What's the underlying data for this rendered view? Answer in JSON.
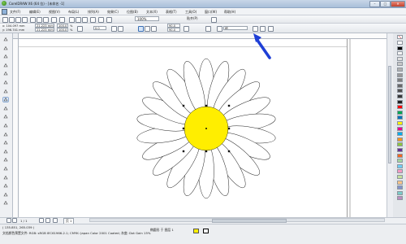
{
  "window": {
    "title": "CorelDRAW X6 (64 位) - [未命名 -1]",
    "minimize": "–",
    "maximize": "□",
    "close": "✕"
  },
  "menu": [
    "文件(F)",
    "编辑(E)",
    "视图(V)",
    "布局(L)",
    "排列(A)",
    "效果(C)",
    "位图(B)",
    "文本(X)",
    "表格(T)",
    "工具(O)",
    "窗口(W)",
    "帮助(H)"
  ],
  "toolbar": {
    "zoom": "100%",
    "snap": "贴齐(P)"
  },
  "property_bar": {
    "x": "x: 104.097 mm",
    "y": "y: 196.741 mm",
    "w": "21.223 mm",
    "h": "21.223 mm",
    "scale_w": "100.0",
    "scale_h": "100.0",
    "percent": "%",
    "angle": "0.0",
    "start_angle": "90.0",
    "end_angle": "90.0",
    "outline": "细"
  },
  "page_nav": {
    "counter": "1 / 1",
    "page_tab": "页 1"
  },
  "status": {
    "coords": "( 135.851, 265.039 )",
    "object_info": "椭圆形 于 图层 1",
    "doc_info": "文档颜色预置文件: RGB: sRGB IEC61966-2.1; CMYK: Japan Color 2001 Coated; 灰度: Dot Gain 15%"
  },
  "colors": {
    "flower_center": "#ffee00",
    "arrow": "#1f3fd6"
  },
  "palette_colors": [
    "#ffffff",
    "#000000",
    "#f5f5f5",
    "#e0e0e0",
    "#c8c8c8",
    "#b0b0b0",
    "#989898",
    "#808080",
    "#686868",
    "#505050",
    "#383838",
    "#202020",
    "#ff0000",
    "#00a651",
    "#0072bc",
    "#fff200",
    "#ec008c",
    "#00aeef",
    "#f7941d",
    "#8dc63f",
    "#662d91",
    "#f26522",
    "#a3d39c",
    "#6dcff6",
    "#f49ac2",
    "#c4df9b",
    "#fdc689",
    "#8393ca",
    "#7accc8",
    "#bd8cbf"
  ]
}
